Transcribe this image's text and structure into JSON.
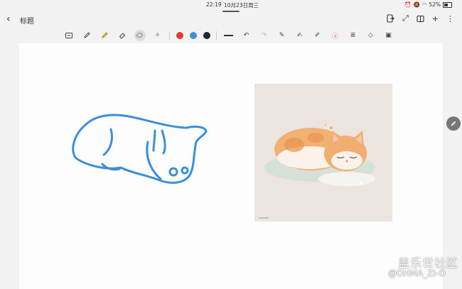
{
  "status": {
    "time": "22:19",
    "date": "10月23日周三",
    "battery": "52%"
  },
  "header": {
    "title": "标题"
  },
  "toolbar": {
    "colors": [
      "#e53935",
      "#3f8fd6",
      "#1c2733"
    ]
  },
  "watermark": {
    "cn": "盖乐世社区",
    "en": "@OHMA_ZI-O"
  },
  "accent": "#3b8fd9"
}
